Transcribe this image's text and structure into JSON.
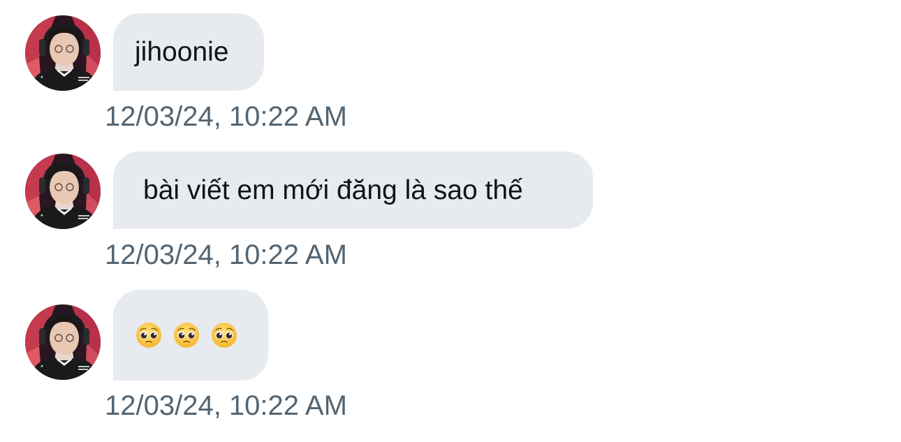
{
  "messages": [
    {
      "text": "jihoonie",
      "timestamp": "12/03/24, 10:22 AM"
    },
    {
      "text": "bài viết em mới đăng là sao thế",
      "timestamp": "12/03/24, 10:22 AM"
    },
    {
      "emoji": [
        "pleading-face",
        "pleading-face",
        "pleading-face"
      ],
      "timestamp": "12/03/24, 10:22 AM"
    }
  ],
  "colors": {
    "bubble_bg": "#e7ebef",
    "text": "#0f1419",
    "timestamp": "#536471"
  }
}
